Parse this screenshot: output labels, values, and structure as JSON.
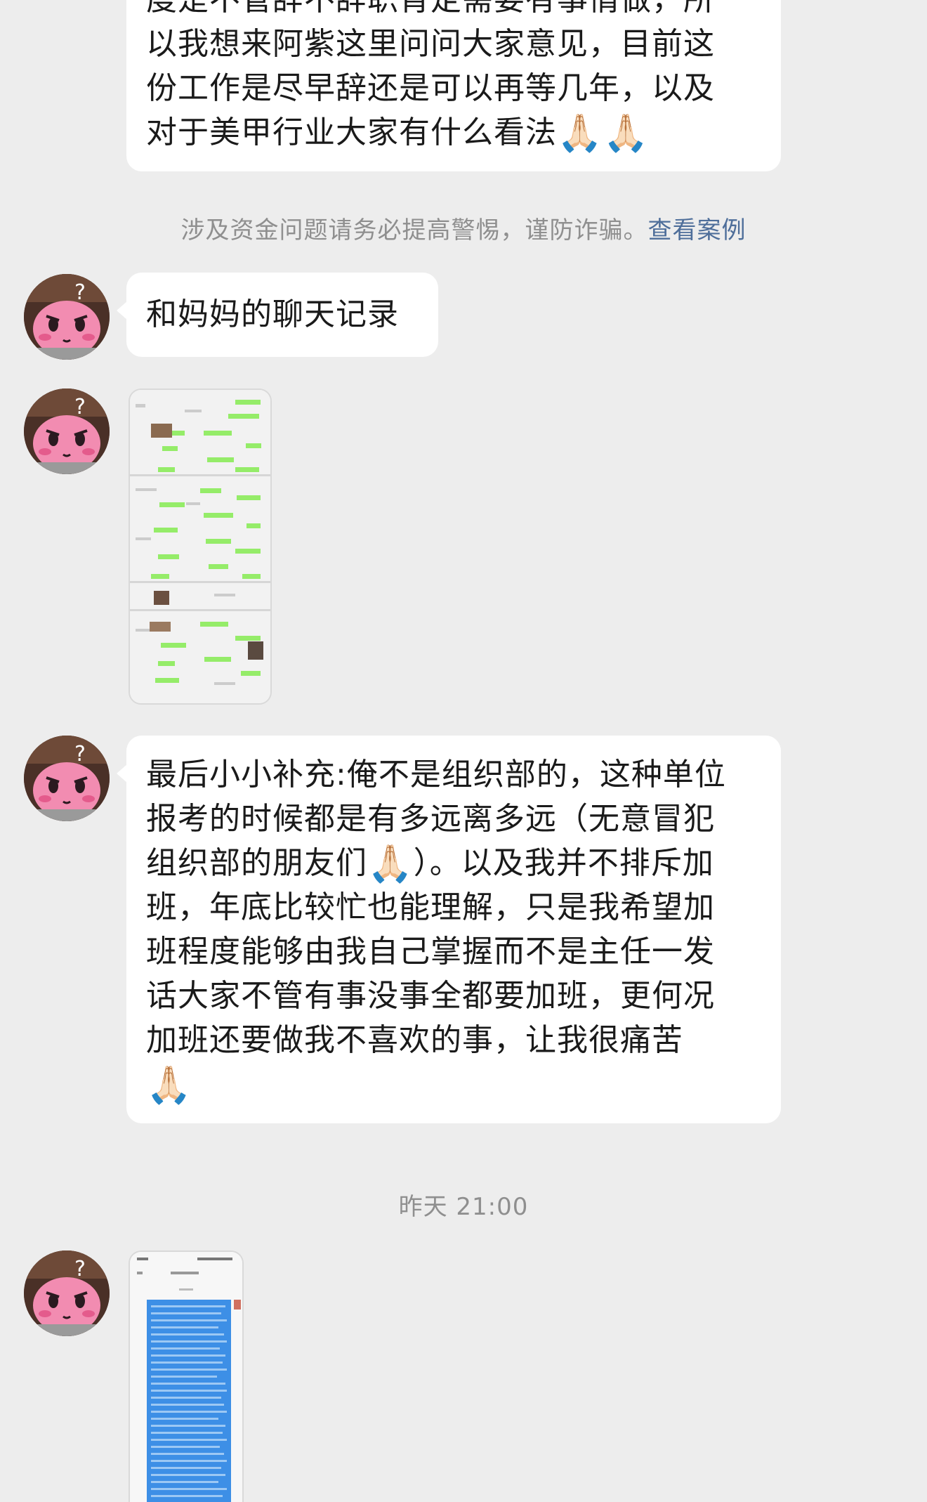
{
  "messages": {
    "first": {
      "lines": [
        "度是不管辞不辞职肯定需要有事情做，所",
        "以我想来阿紫这里问问大家意见，目前这",
        "份工作是尽早辞还是可以再等几年，以及",
        "对于美甲行业大家有什么看法"
      ],
      "emoji": "🙏🏻🙏🏻"
    },
    "notice": {
      "text": "涉及资金问题请务必提高警惕，谨防诈骗。",
      "link": "查看案例"
    },
    "mom_chat": {
      "text": "和妈妈的聊天记录"
    },
    "supplement": {
      "line1": "最后小小补充:俺不是组织部的，这种单位",
      "line2": "报考的时候都是有多远离多远（无意冒犯",
      "line3_a": "组织部的朋友们",
      "line3_emoji": "🙏🏻",
      "line3_b": "）。以及我并不排斥加",
      "line4": "班，年底比较忙也能理解，只是我希望加",
      "line5": "班程度能够由我自己掌握而不是主任一发",
      "line6": "话大家不管有事没事全都要加班，更何况",
      "line7": "加班还要做我不喜欢的事，让我很痛苦",
      "line8_emoji": "🙏🏻"
    },
    "timestamp": "昨天 21:00"
  },
  "colors": {
    "background": "#ededed",
    "bubble": "#ffffff",
    "link": "#4e6e9a",
    "system_text": "#8f8f8f",
    "wechat_green": "#95ec69",
    "note_blue": "#3d8fe6"
  },
  "icons": {
    "avatar": "kirby-avatar",
    "thumb1": "chat-screenshot-thumbnail",
    "thumb2": "note-screenshot-thumbnail"
  }
}
